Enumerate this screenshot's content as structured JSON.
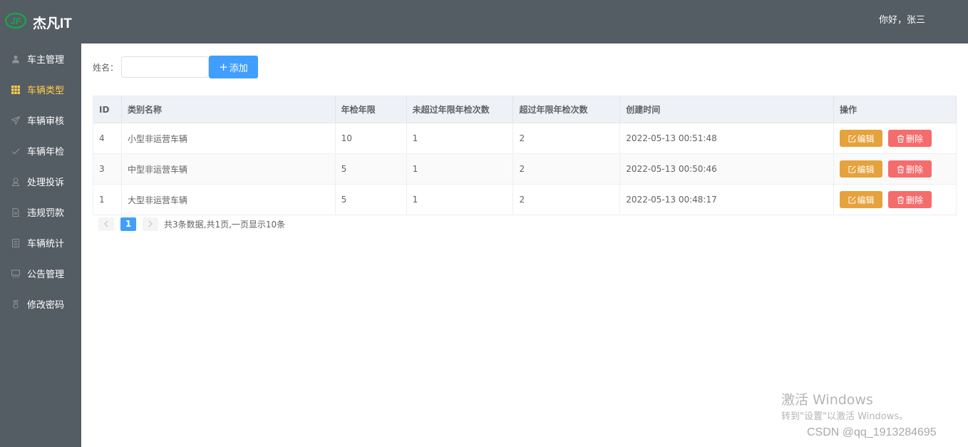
{
  "header": {
    "brand": "杰凡IT",
    "greeting": "你好，张三"
  },
  "colors": {
    "sidebar_bg": "#545c64",
    "active_menu": "#ffd04b",
    "primary": "#409eff",
    "warning": "#e6a23c",
    "danger": "#f56c6c",
    "logo_green": "#1aa34a"
  },
  "sidebar": {
    "items": [
      {
        "label": "车主管理",
        "icon": "user-icon",
        "active": false
      },
      {
        "label": "车辆类型",
        "icon": "grid-icon",
        "active": true
      },
      {
        "label": "车辆审核",
        "icon": "send-icon",
        "active": false
      },
      {
        "label": "车辆年检",
        "icon": "check-icon",
        "active": false
      },
      {
        "label": "处理投诉",
        "icon": "service-icon",
        "active": false
      },
      {
        "label": "违规罚款",
        "icon": "document-icon",
        "active": false
      },
      {
        "label": "车辆统计",
        "icon": "tickets-icon",
        "active": false
      },
      {
        "label": "公告管理",
        "icon": "board-icon",
        "active": false
      },
      {
        "label": "修改密码",
        "icon": "medal-icon",
        "active": false
      }
    ]
  },
  "toolbar": {
    "name_label": "姓名：",
    "name_value": "",
    "name_placeholder": "",
    "add_label": "添加"
  },
  "table": {
    "columns": [
      "ID",
      "类别名称",
      "年检年限",
      "未超过年限年检次数",
      "超过年限年检次数",
      "创建时间",
      "操作"
    ],
    "rows": [
      {
        "id": "4",
        "name": "小型非运营车辆",
        "years": "10",
        "under": "1",
        "over": "2",
        "created": "2022-05-13 00:51:48"
      },
      {
        "id": "3",
        "name": "中型非运营车辆",
        "years": "5",
        "under": "1",
        "over": "2",
        "created": "2022-05-13 00:50:46"
      },
      {
        "id": "1",
        "name": "大型非运营车辆",
        "years": "5",
        "under": "1",
        "over": "2",
        "created": "2022-05-13 00:48:17"
      }
    ],
    "edit_label": "编辑",
    "delete_label": "删除"
  },
  "pagination": {
    "current_page": "1",
    "info": "共3条数据,共1页,一页显示10条"
  },
  "watermark": {
    "title": "激活 Windows",
    "subtitle": "转到\"设置\"以激活 Windows。",
    "csdn": "CSDN @qq_1913284695"
  }
}
